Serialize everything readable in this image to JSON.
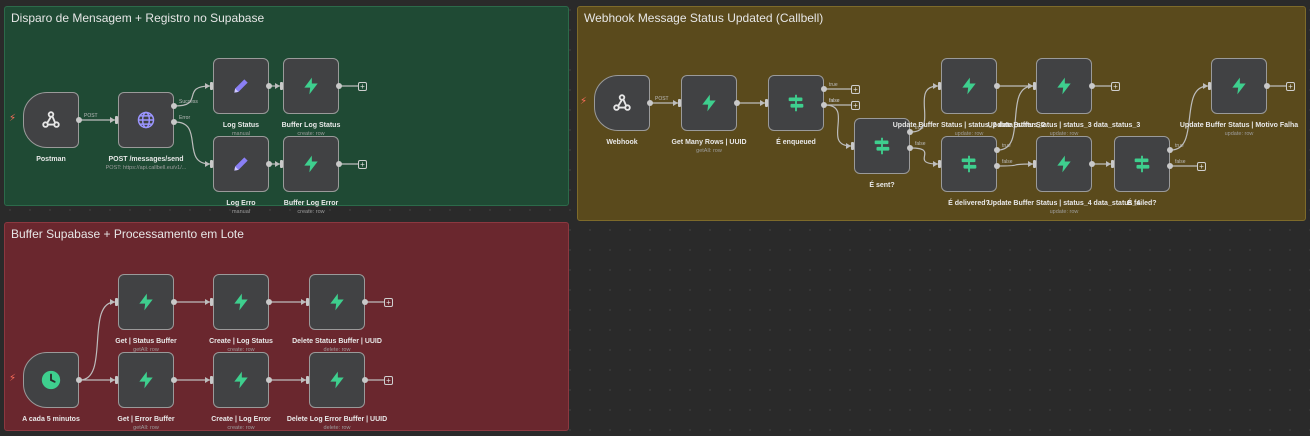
{
  "colors": {
    "supabase": "#3ecf8e",
    "edit": "#8a7ff6",
    "webhook": "#e6e6e6",
    "postman": "#e6e6e6",
    "http": "#9b95ff",
    "if": "#3ecf8e",
    "schedule": "#3ecf8e",
    "trigger_bolt": "#ff6d5a"
  },
  "groups": [
    {
      "id": "g1",
      "title": "Disparo de Mensagem + Registro no Supabase",
      "bg": "#1f4a34",
      "border": "#2c6a4a"
    },
    {
      "id": "g2",
      "title": "Webhook Message Status Updated (Callbell)",
      "bg": "#5a4a1c",
      "border": "#7d6a2a"
    },
    {
      "id": "g3",
      "title": "Buffer Supabase + Processamento em Lote",
      "bg": "#6a272e",
      "border": "#8c3840"
    }
  ],
  "nodes": [
    {
      "id": "postman",
      "label": "Postman",
      "sub": "",
      "icon": "webhook-icon",
      "trigger": true
    },
    {
      "id": "post_send",
      "label": "POST /messages/send",
      "sub": "POST: https://api.callbell.eu/v1/...",
      "icon": "globe-icon"
    },
    {
      "id": "log_status",
      "label": "Log Status",
      "sub": "manual",
      "icon": "pencil-icon"
    },
    {
      "id": "buffer_log_status",
      "label": "Buffer Log Status",
      "sub": "create: row",
      "icon": "supabase-icon"
    },
    {
      "id": "log_erro",
      "label": "Log Erro",
      "sub": "manual",
      "icon": "pencil-icon"
    },
    {
      "id": "buffer_log_error",
      "label": "Buffer Log Error",
      "sub": "create: row",
      "icon": "supabase-icon"
    },
    {
      "id": "webhook",
      "label": "Webhook",
      "sub": "",
      "icon": "webhook-icon",
      "trigger": true
    },
    {
      "id": "get_many",
      "label": "Get Many Rows | UUID",
      "sub": "getAll: row",
      "icon": "supabase-icon"
    },
    {
      "id": "e_enqueued",
      "label": "É enqueued",
      "sub": "",
      "icon": "if-icon"
    },
    {
      "id": "e_sent",
      "label": "É sent?",
      "sub": "",
      "icon": "if-icon"
    },
    {
      "id": "upd2",
      "label": "Update Buffer Status | status_2 data_status_2",
      "sub": "update: row",
      "icon": "supabase-icon"
    },
    {
      "id": "e_delivered",
      "label": "É delivered?",
      "sub": "",
      "icon": "if-icon"
    },
    {
      "id": "upd3",
      "label": "Update Buffer Status | status_3 data_status_3",
      "sub": "update: row",
      "icon": "supabase-icon"
    },
    {
      "id": "upd4",
      "label": "Update Buffer Status | status_4 data_status_4",
      "sub": "update: row",
      "icon": "supabase-icon"
    },
    {
      "id": "e_failed",
      "label": "É failed?",
      "sub": "",
      "icon": "if-icon"
    },
    {
      "id": "upd_falha",
      "label": "Update Buffer Status | Motivo Falha",
      "sub": "update: row",
      "icon": "supabase-icon"
    },
    {
      "id": "a_cada",
      "label": "A cada 5 minutos",
      "sub": "",
      "icon": "clock-icon",
      "trigger": true
    },
    {
      "id": "get_status_buffer",
      "label": "Get | Status Buffer",
      "sub": "getAll: row",
      "icon": "supabase-icon"
    },
    {
      "id": "create_log_status",
      "label": "Create | Log Status",
      "sub": "create: row",
      "icon": "supabase-icon"
    },
    {
      "id": "delete_status_buffer",
      "label": "Delete Status Buffer | UUID",
      "sub": "delete: row",
      "icon": "supabase-icon"
    },
    {
      "id": "get_error_buffer",
      "label": "Get | Error Buffer",
      "sub": "getAll: row",
      "icon": "supabase-icon"
    },
    {
      "id": "create_log_error",
      "label": "Create | Log Error",
      "sub": "create: row",
      "icon": "supabase-icon"
    },
    {
      "id": "delete_log_error_buffer",
      "label": "Delete Log Error Buffer | UUID",
      "sub": "delete: row",
      "icon": "supabase-icon"
    }
  ],
  "edge_labels": {
    "post": "POST",
    "success": "Success",
    "error": "Error",
    "true": "true",
    "false": "false"
  }
}
